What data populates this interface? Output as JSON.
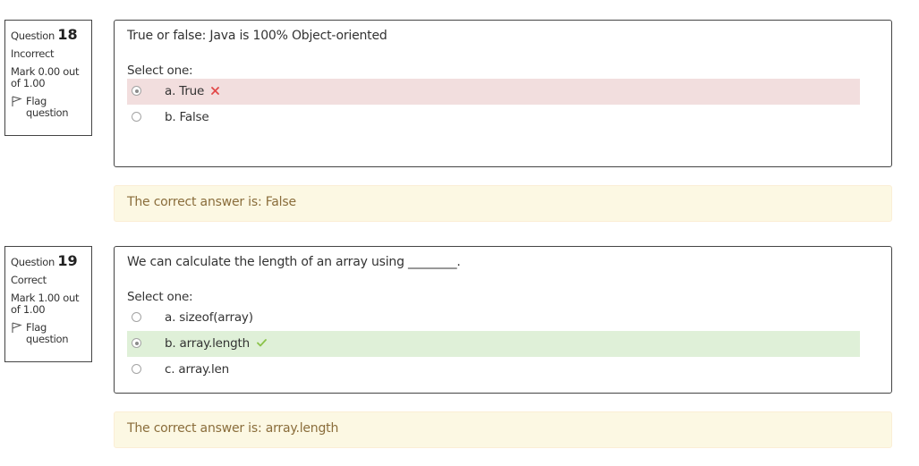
{
  "questions": [
    {
      "question_label": "Question",
      "number": "18",
      "state": "Incorrect",
      "grade": "Mark 0.00 out of 1.00",
      "flag_label": "Flag question",
      "text": "True or false: Java is 100% Object-oriented",
      "prompt": "Select one:",
      "options": [
        {
          "label": "a. True",
          "checked": true,
          "result": "incorrect",
          "mark_icon": "cross-icon"
        },
        {
          "label": "b. False",
          "checked": false,
          "result": "none"
        }
      ],
      "right_answer": "The correct answer is: False"
    },
    {
      "question_label": "Question",
      "number": "19",
      "state": "Correct",
      "grade": "Mark 1.00 out of 1.00",
      "flag_label": "Flag question",
      "text": "We can calculate the length of an array using ________.",
      "prompt": "Select one:",
      "options": [
        {
          "label": "a. sizeof(array)",
          "checked": false,
          "result": "none"
        },
        {
          "label": "b. array.length",
          "checked": true,
          "result": "correct",
          "mark_icon": "check-icon"
        },
        {
          "label": "c. array.len",
          "checked": false,
          "result": "none"
        }
      ],
      "right_answer": "The correct answer is: array.length"
    }
  ],
  "colors": {
    "incorrect_bg": "#f2dede",
    "correct_bg": "#dff0d8",
    "feedback_bg": "#fcf8e3",
    "feedback_text": "#8a6d3b",
    "cross": "#e24a4a",
    "check": "#8bc34a"
  }
}
